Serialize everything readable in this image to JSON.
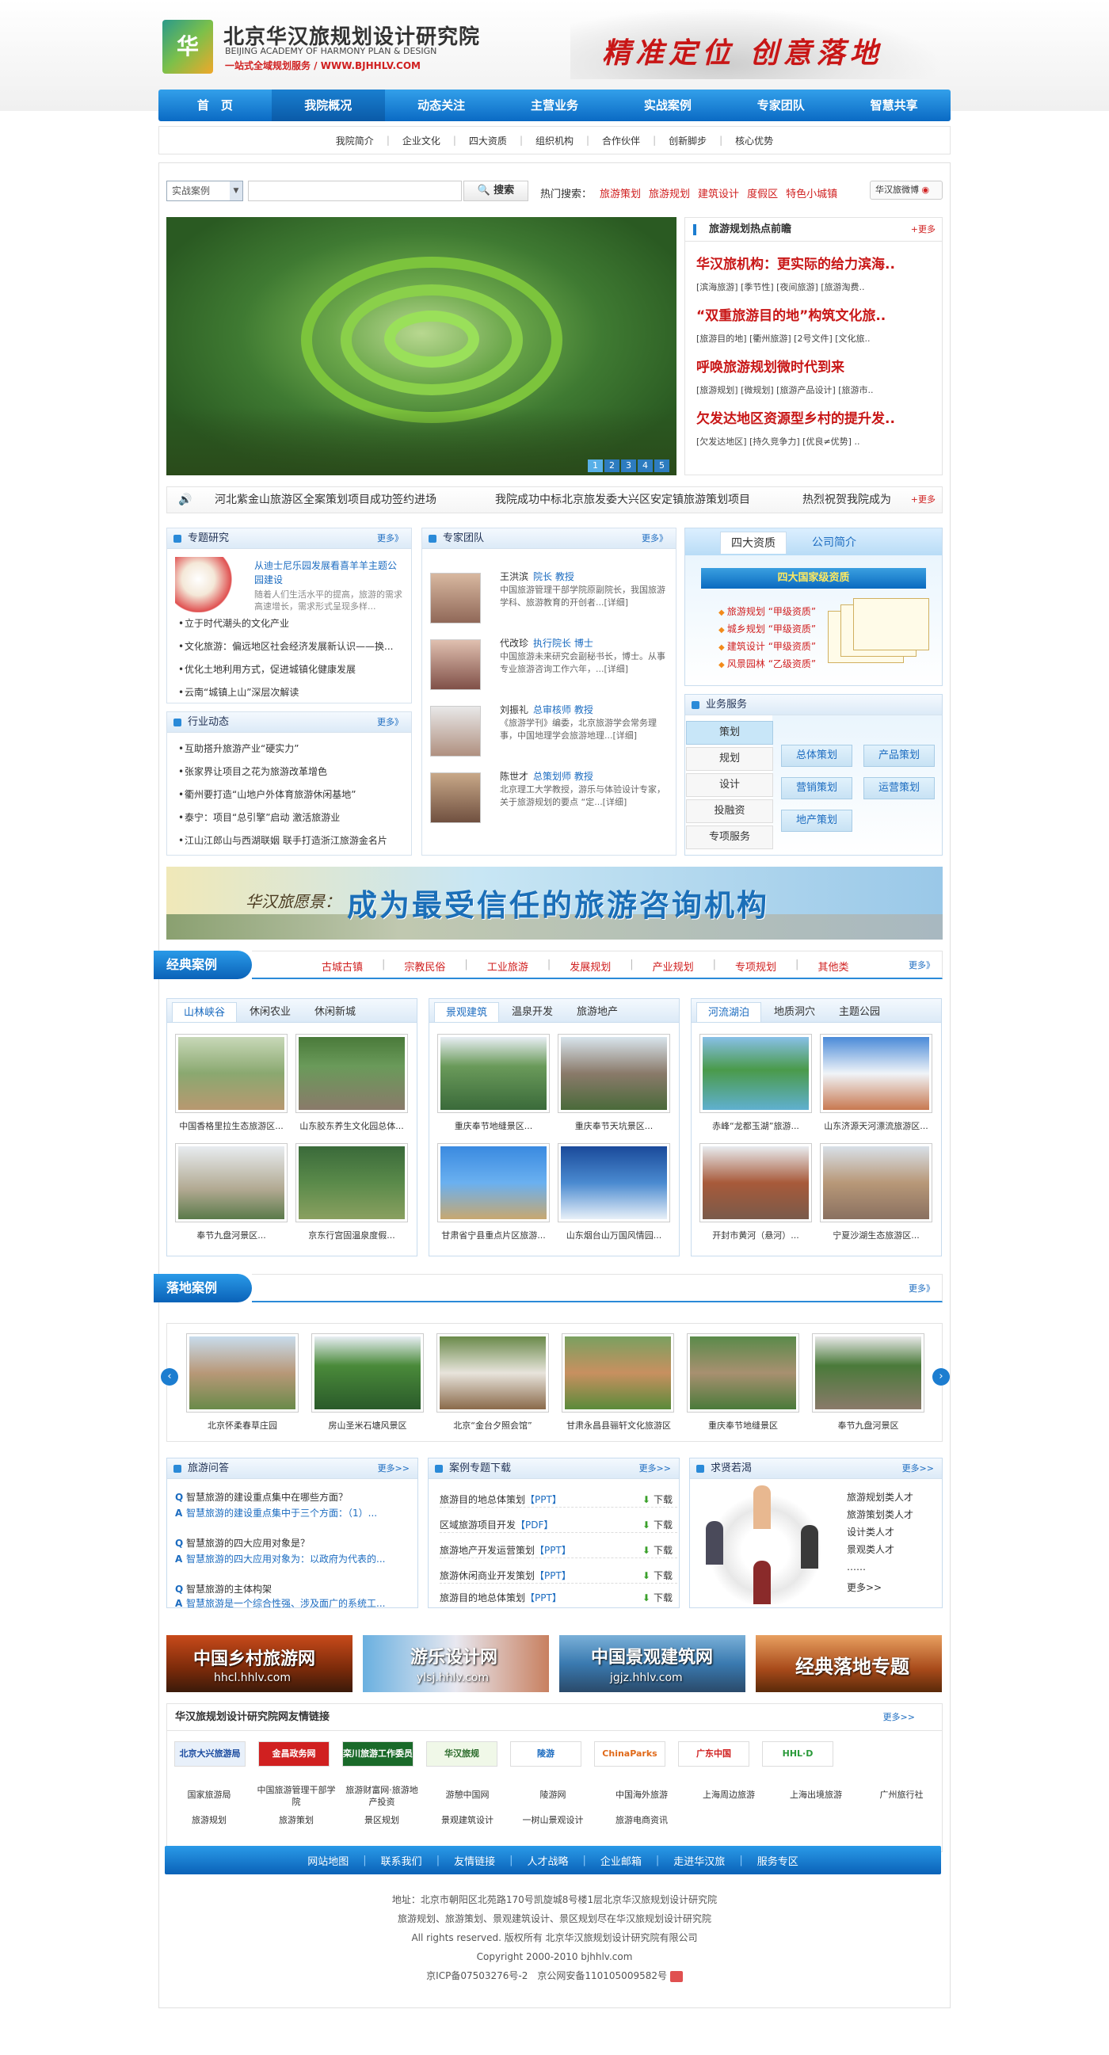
{
  "header": {
    "logo_mark": "华",
    "logo_cn": "北京华汉旅规划设计研究院",
    "logo_en1": "BEIJING ACADEMY OF HARMONY PLAN & DESIGN",
    "logo_tag": "一站式全域规划服务 / WWW.BJHHLV.COM",
    "slogan": "精准定位 创意落地"
  },
  "nav": [
    "首　页",
    "我院概况",
    "动态关注",
    "主营业务",
    "实战案例",
    "专家团队",
    "智慧共享"
  ],
  "nav_active": 1,
  "subnav": [
    "我院简介",
    "企业文化",
    "四大资质",
    "组织机构",
    "合作伙伴",
    "创新脚步",
    "核心优势"
  ],
  "search": {
    "select": "实战案例",
    "button": "搜索",
    "hot_label": "热门搜索：",
    "hot": [
      "旅游策划",
      "旅游规划",
      "建筑设计",
      "度假区",
      "特色小城镇"
    ],
    "weibo": "华汉旅微博"
  },
  "banner_pages": [
    "1",
    "2",
    "3",
    "4",
    "5"
  ],
  "hot_news": {
    "title": "旅游规划热点前瞻",
    "more": "+更多",
    "items": [
      {
        "title": "华汉旅机构：更实际的给力滨海..",
        "tags": "[滨海旅游] [季节性] [夜间旅游] [旅游淘费.."
      },
      {
        "title": "“双重旅游目的地”构筑文化旅..",
        "tags": "[旅游目的地] [衢州旅游] [2号文件] [文化旅.."
      },
      {
        "title": "呼唤旅游规划微时代到来",
        "tags": "[旅游规划] [微规划] [旅游产品设计] [旅游市.."
      },
      {
        "title": "欠发达地区资源型乡村的提升发..",
        "tags": "[欠发达地区] [持久竞争力] [优良≠优势] .."
      }
    ]
  },
  "scroll_news": {
    "items": [
      "河北紫金山旅游区全案策划项目成功签约进场",
      "我院成功中标北京旅发委大兴区安定镇旅游策划项目",
      "热烈祝贺我院成为"
    ],
    "more": "+更多"
  },
  "research": {
    "title": "专题研究",
    "more": "更多》",
    "feature_title": "从迪士尼乐园发展看喜羊羊主题公园建设",
    "feature_desc": "随着人们生活水平的提高，旅游的需求高速增长，需求形式呈现多样...",
    "items": [
      "立于时代潮头的文化产业",
      "文化旅游：偏远地区社会经济发展新认识——换...",
      "优化土地利用方式，促进城镇化健康发展",
      "云南“城镇上山”深层次解读"
    ]
  },
  "industry": {
    "title": "行业动态",
    "more": "更多》",
    "items": [
      "互助搭升旅游产业“硬实力”",
      "张家界让项目之花为旅游改革增色",
      "衢州要打造“山地户外体育旅游休闲基地”",
      "泰宁：项目“总引擎”启动 激活旅游业",
      "江山江郎山与西湖联姻 联手打造浙江旅游金名片"
    ]
  },
  "experts": {
    "title": "专家团队",
    "more": "更多》",
    "items": [
      {
        "name": "王洪滨",
        "role": "院长 教授",
        "desc": "中国旅游管理干部学院原副院长，我国旅游学科、旅游教育的开创者...[详细]"
      },
      {
        "name": "代改珍",
        "role": "执行院长 博士",
        "desc": "中国旅游未来研究会副秘书长，博士。从事专业旅游咨询工作六年，...[详细]"
      },
      {
        "name": "刘振礼",
        "role": "总审核师 教授",
        "desc": "《旅游学刊》编委，北京旅游学会常务理事，中国地理学会旅游地理...[详细]"
      },
      {
        "name": "陈世才",
        "role": "总策划师 教授",
        "desc": "北京理工大学教授，游乐与体验设计专家，关于旅游规划的要点 “定...[详细]"
      }
    ]
  },
  "qual": {
    "tab1": "四大资质",
    "tab2": "公司简介",
    "ribbon": "四大国家级资质",
    "items": [
      "旅游规划 “甲级资质”",
      "城乡规划 “甲级资质”",
      "建筑设计 “甲级资质”",
      "风景园林 “乙级资质”"
    ]
  },
  "biz": {
    "title": "业务服务",
    "left": [
      "策划",
      "规划",
      "设计",
      "投融资",
      "专项服务"
    ],
    "buttons": [
      "总体策划",
      "产品策划",
      "营销策划",
      "运营策划",
      "地产策划"
    ]
  },
  "ad": {
    "a1": "华汉旅愿景：",
    "a2": "成为最受信任的旅游咨询机构"
  },
  "classic": {
    "label": "经典案例",
    "more": "更多》",
    "cats": [
      "古城古镇",
      "宗教民俗",
      "工业旅游",
      "发展规划",
      "产业规划",
      "专项规划",
      "其他类"
    ],
    "panels": [
      {
        "tabs": [
          "山林峡谷",
          "休闲农业",
          "休闲新城"
        ],
        "caps": [
          "中国香格里拉生态旅游区...",
          "山东胶东养生文化园总体...",
          "奉节九盘河景区...",
          "京东行宫固温泉度假..."
        ]
      },
      {
        "tabs": [
          "景观建筑",
          "温泉开发",
          "旅游地产"
        ],
        "caps": [
          "重庆奉节地缝景区...",
          "重庆奉节天坑景区...",
          "甘肃省宁县重点片区旅游...",
          "山东烟台山万国风情园..."
        ]
      },
      {
        "tabs": [
          "河流湖泊",
          "地质洞穴",
          "主题公园"
        ],
        "caps": [
          "赤峰“龙都玉湖”旅游...",
          "山东济源天河漂流旅游区...",
          "开封市黄河（悬河）...",
          "宁夏沙湖生态旅游区..."
        ]
      }
    ]
  },
  "landing": {
    "label": "落地案例",
    "more": "更多》",
    "items": [
      "北京怀柔春草庄园",
      "房山圣米石塘风景区",
      "北京“金台夕照会馆”",
      "甘肃永昌县骊轩文化旅游区",
      "重庆奉节地缝景区",
      "奉节九盘河景区"
    ]
  },
  "qa": {
    "title": "旅游问答",
    "more": "更多>>",
    "items": [
      {
        "q": "智慧旅游的建设重点集中在哪些方面？",
        "a": "智慧旅游的建设重点集中于三个方面：（1）..."
      },
      {
        "q": "智慧旅游的四大应用对象是？",
        "a": "智慧旅游的四大应用对象为：以政府为代表的..."
      },
      {
        "q": "智慧旅游的主体构架",
        "a": "智慧旅游是一个综合性强、涉及面广的系统工..."
      }
    ]
  },
  "downloads": {
    "title": "案例专题下载",
    "more": "更多>>",
    "dl": "下载",
    "items": [
      {
        "n": "旅游目的地总体策划",
        "f": "【PPT】"
      },
      {
        "n": "区域旅游项目开发",
        "f": "【PDF】"
      },
      {
        "n": "旅游地产开发运营策划",
        "f": "【PPT】"
      },
      {
        "n": "旅游休闲商业开发策划",
        "f": "【PPT】"
      },
      {
        "n": "旅游目的地总体策划",
        "f": "【PPT】"
      }
    ]
  },
  "jobs": {
    "title": "求贤若渴",
    "more": "更多>>",
    "items": [
      "旅游规划类人才",
      "旅游策划类人才",
      "设计类人才",
      "景观类人才",
      "……"
    ],
    "more2": "更多>>"
  },
  "partners": [
    {
      "t": "中国乡村旅游网",
      "s": "hhcl.hhlv.com"
    },
    {
      "t": "游乐设计网",
      "s": "ylsj.hhlv.com"
    },
    {
      "t": "中国景观建筑网",
      "s": "jgjz.hhlv.com"
    },
    {
      "t": "经典落地专题",
      "s": ""
    }
  ],
  "links": {
    "title": "华汉旅规划设计研究院网友情链接",
    "more": "更多>>",
    "logos": [
      "北京大兴旅游局",
      "金昌政务网",
      "栾川旅游工作委员会",
      "华汉旅规",
      "陵游",
      "ChinaParks",
      "广东中国",
      "HHL·D"
    ],
    "row1": [
      "国家旅游局",
      "中国旅游管理干部学院",
      "旅游财富网·旅游地产投资",
      "游憩中国网",
      "陵游网",
      "中国海外旅游",
      "上海周边旅游",
      "上海出境旅游",
      "广州旅行社"
    ],
    "row2": [
      "旅游规划",
      "旅游策划",
      "景区规划",
      "景观建筑设计",
      "一树山景观设计",
      "旅游电商资讯"
    ]
  },
  "footer_nav": [
    "网站地图",
    "联系我们",
    "友情链接",
    "人才战略",
    "企业邮箱",
    "走进华汉旅",
    "服务专区"
  ],
  "footer": [
    "地址：北京市朝阳区北苑路170号凯旋城8号楼1层北京华汉旅规划设计研究院",
    "旅游规划、旅游策划、景观建筑设计、景区规划尽在华汉旅规划设计研究院",
    "All rights reserved. 版权所有 北京华汉旅规划设计研究院有限公司",
    "Copyright 2000-2010 bjhhlv.com",
    "京ICP备07503276号-2　京公网安备110105009582号"
  ]
}
